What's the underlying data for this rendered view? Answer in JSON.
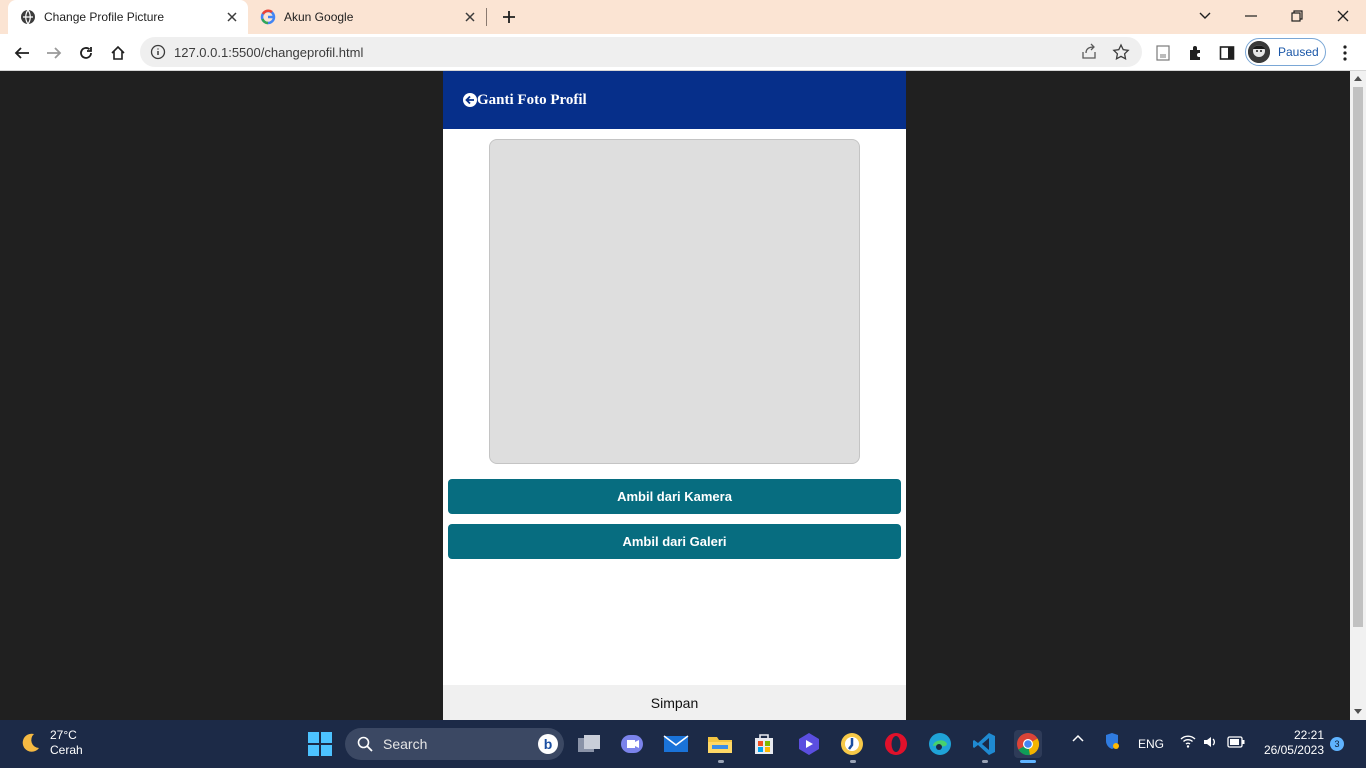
{
  "browser": {
    "tabs": [
      {
        "title": "Change Profile Picture",
        "active": true
      },
      {
        "title": "Akun Google",
        "active": false
      }
    ],
    "url": "127.0.0.1:5500/changeprofil.html",
    "profile_status": "Paused"
  },
  "app": {
    "header_title": "Ganti Foto Profil",
    "buttons": {
      "camera": "Ambil dari Kamera",
      "gallery": "Ambil dari Galeri"
    },
    "footer_label": "Simpan",
    "colors": {
      "header": "#062f8a",
      "button": "#076d80"
    }
  },
  "taskbar": {
    "weather_temp": "27°C",
    "weather_desc": "Cerah",
    "search_placeholder": "Search",
    "language": "ENG",
    "time": "22:21",
    "date": "26/05/2023",
    "notification_count": "3"
  }
}
